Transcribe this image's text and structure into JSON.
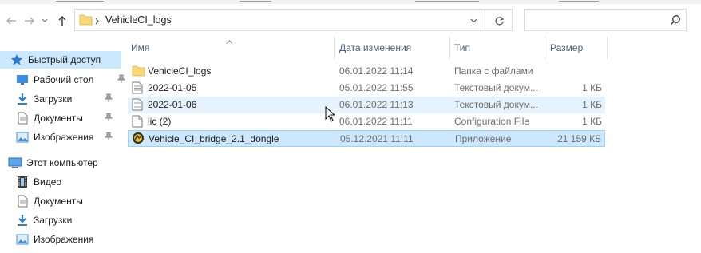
{
  "address": {
    "path": "VehicleCI_logs"
  },
  "search": {
    "placeholder": ""
  },
  "sidebar": {
    "items": [
      {
        "label": "Быстрый доступ",
        "icon": "star-icon"
      },
      {
        "label": "Рабочий стол",
        "icon": "desktop-icon",
        "pinned": true
      },
      {
        "label": "Загрузки",
        "icon": "download-icon",
        "pinned": true
      },
      {
        "label": "Документы",
        "icon": "documents-icon",
        "pinned": true
      },
      {
        "label": "Изображения",
        "icon": "pictures-icon",
        "pinned": true
      },
      {
        "label": "Этот компьютер",
        "icon": "computer-icon"
      },
      {
        "label": "Видео",
        "icon": "video-icon"
      },
      {
        "label": "Документы",
        "icon": "documents-icon"
      },
      {
        "label": "Загрузки",
        "icon": "download-icon"
      },
      {
        "label": "Изображения",
        "icon": "pictures-icon"
      }
    ]
  },
  "columns": {
    "name": "Имя",
    "date": "Дата изменения",
    "type": "Тип",
    "size": "Размер"
  },
  "files": [
    {
      "name": "VehicleCI_logs",
      "date": "06.01.2022 11:14",
      "type": "Папка с файлами",
      "size": "",
      "icon": "folder-icon"
    },
    {
      "name": "2022-01-05",
      "date": "05.01.2022 11:55",
      "type": "Текстовый докум...",
      "size": "1 КБ",
      "icon": "text-file-icon"
    },
    {
      "name": "2022-01-06",
      "date": "06.01.2022 11:13",
      "type": "Текстовый докум...",
      "size": "1 КБ",
      "icon": "text-file-icon",
      "state": "hover"
    },
    {
      "name": "lic (2)",
      "date": "06.01.2022 11:11",
      "type": "Configuration File",
      "size": "1 КБ",
      "icon": "config-file-icon"
    },
    {
      "name": "Vehicle_CI_bridge_2.1_dongle",
      "date": "05.12.2021 11:11",
      "type": "Приложение",
      "size": "21 159 КБ",
      "icon": "application-icon",
      "state": "selected"
    }
  ],
  "colors": {
    "selection": "#cce8ff",
    "selection_border": "#99d1ff",
    "hover": "#e5f3ff",
    "folder": "#f8d775",
    "header_text": "#4c607a"
  }
}
